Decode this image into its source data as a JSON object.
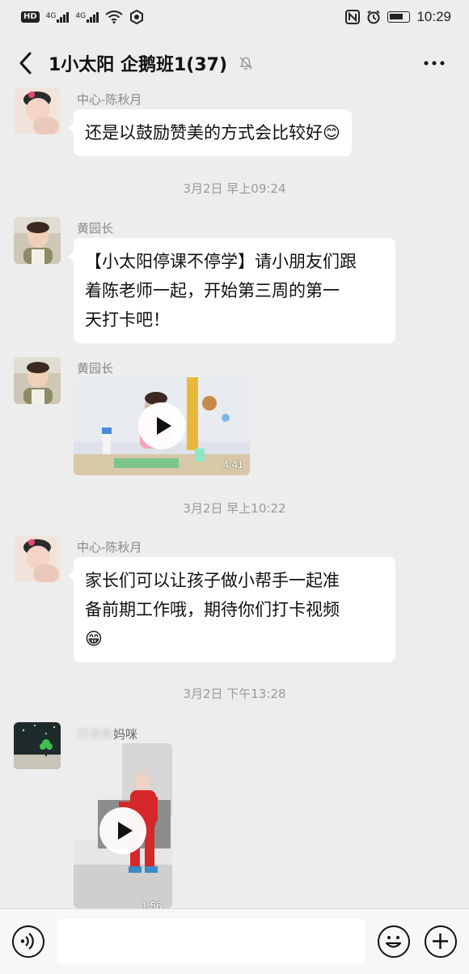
{
  "status_bar": {
    "hd": "HD",
    "net1": "4G",
    "net2": "4G",
    "time": "10:29",
    "icons": [
      "hd-icon",
      "signal-icon",
      "wifi-icon",
      "nfc-icon",
      "alarm-icon",
      "battery-icon"
    ]
  },
  "header": {
    "title": "1小太阳 企鹅班1(37)",
    "back_icon": "chevron-left-icon",
    "mute_icon": "bell-muted-icon",
    "more_icon": "more-icon"
  },
  "messages": [
    {
      "type": "text",
      "sender": "中心-陈秋月",
      "text": "还是以鼓励赞美的方式会比较好😊"
    },
    {
      "type": "time",
      "text": "3月2日 早上09:24"
    },
    {
      "type": "text",
      "sender": "黄园长",
      "lines": [
        "【小太阳停课不停学】请小朋友们跟",
        "着陈老师一起，开始第三周的第一",
        "天打卡吧！"
      ]
    },
    {
      "type": "video",
      "sender": "黄园长",
      "duration": "4:41"
    },
    {
      "type": "time",
      "text": "3月2日 早上10:22"
    },
    {
      "type": "text",
      "sender": "中心-陈秋月",
      "lines": [
        "家长们可以让孩子做小帮手一起准",
        "备前期工作哦，期待你们打卡视频",
        "😁"
      ]
    },
    {
      "type": "time",
      "text": "3月2日 下午13:28"
    },
    {
      "type": "video",
      "sender_blurred": "邓承希",
      "sender_suffix": "妈咪",
      "duration": "1:56"
    }
  ],
  "bottom_bar": {
    "voice_icon": "voice-icon",
    "emoji_icon": "emoji-icon",
    "plus_icon": "plus-icon",
    "input_value": ""
  },
  "colors": {
    "background": "#ededed",
    "bubble": "#ffffff",
    "timestamp": "#9a9a9a",
    "sender": "#888888"
  }
}
